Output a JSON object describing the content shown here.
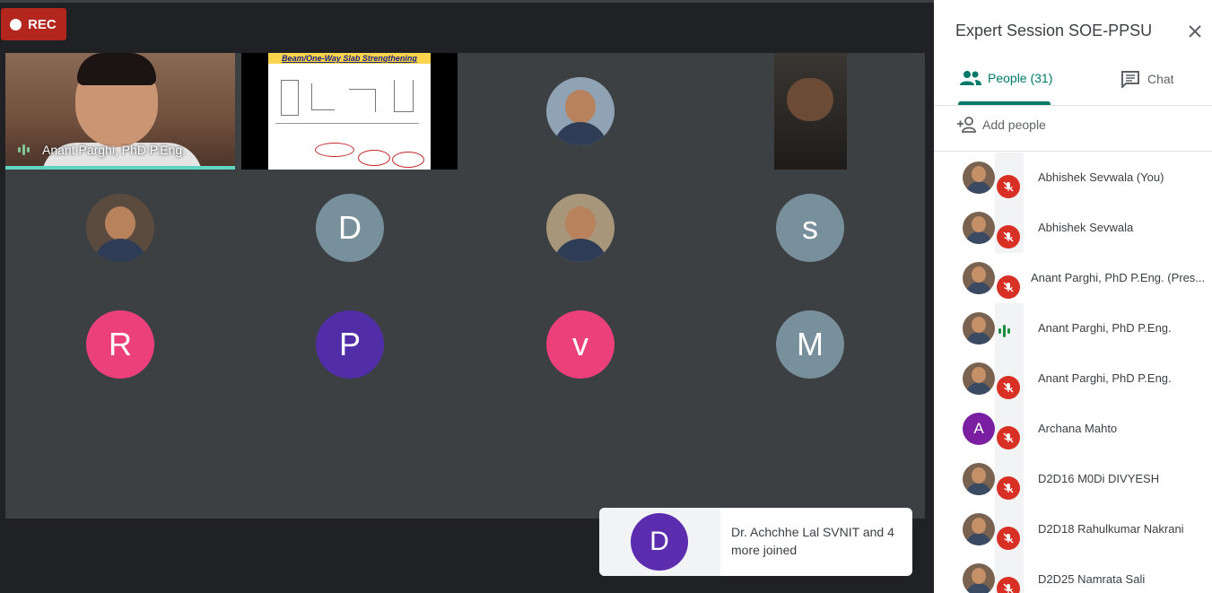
{
  "meeting": {
    "rec_label": "REC",
    "speaker_name": "Anant Parghi, PhD P.Eng.",
    "slide_title": "Beam/One-Way Slab Strengthening",
    "tiles": [
      {
        "type": "photo"
      },
      {
        "type": "photo"
      },
      {
        "type": "photo"
      },
      {
        "type": "photo"
      },
      {
        "type": "photo"
      },
      {
        "type": "letter",
        "letter": "D",
        "color": "#78909c"
      },
      {
        "type": "photo"
      },
      {
        "type": "letter",
        "letter": "s",
        "color": "#78909c"
      },
      {
        "type": "letter",
        "letter": "R",
        "color": "#ec407a"
      },
      {
        "type": "letter",
        "letter": "P",
        "color": "#512da8"
      },
      {
        "type": "letter",
        "letter": "v",
        "color": "#ec407a"
      },
      {
        "type": "letter",
        "letter": "M",
        "color": "#78909c"
      }
    ]
  },
  "notification": {
    "avatar_letter": "D",
    "text": "Dr. Achchhe Lal SVNIT and 4 more joined"
  },
  "panel": {
    "title": "Expert Session SOE-PPSU",
    "tab_people": "People (31)",
    "tab_chat": "Chat",
    "add_people": "Add people",
    "people": [
      {
        "name": "Abhishek Sevwala (You)",
        "status": "muted",
        "avatar": "photo"
      },
      {
        "name": "Abhishek Sevwala",
        "status": "muted",
        "avatar": "photo"
      },
      {
        "name": "Anant Parghi, PhD P.Eng. (Pres...",
        "status": "muted",
        "avatar": "photo",
        "presenting": true
      },
      {
        "name": "Anant Parghi, PhD P.Eng.",
        "status": "speaking",
        "avatar": "photo"
      },
      {
        "name": "Anant Parghi, PhD P.Eng.",
        "status": "muted",
        "avatar": "photo"
      },
      {
        "name": "Archana Mahto",
        "status": "muted",
        "avatar": "letter",
        "letter": "A",
        "color": "#7b1fa2"
      },
      {
        "name": "D2D16 M0Di DIVYESH",
        "status": "muted",
        "avatar": "photo"
      },
      {
        "name": "D2D18 Rahulkumar Nakrani",
        "status": "muted",
        "avatar": "photo"
      },
      {
        "name": "D2D25 Namrata Sali",
        "status": "muted",
        "avatar": "photo"
      }
    ]
  }
}
